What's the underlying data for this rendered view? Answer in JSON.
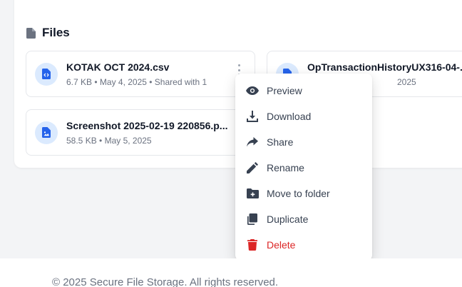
{
  "section": {
    "title": "Files",
    "icon": "document-icon"
  },
  "files": [
    {
      "name": "KOTAK OCT 2024.csv",
      "meta": "6.7 KB • May 4, 2025 • Shared with 1",
      "icon": "code-file-icon"
    },
    {
      "name": "OpTransactionHistoryUX316-04-...",
      "meta": "2025",
      "icon": "document-file-icon"
    },
    {
      "name": "Screenshot 2025-02-19 220856.p...",
      "meta": "58.5 KB • May 5, 2025",
      "icon": "image-file-icon"
    }
  ],
  "menu": {
    "items": [
      {
        "label": "Preview",
        "icon": "eye-icon"
      },
      {
        "label": "Download",
        "icon": "download-icon"
      },
      {
        "label": "Share",
        "icon": "share-icon"
      },
      {
        "label": "Rename",
        "icon": "pencil-icon"
      },
      {
        "label": "Move to folder",
        "icon": "folder-plus-icon"
      },
      {
        "label": "Duplicate",
        "icon": "copy-icon"
      },
      {
        "label": "Delete",
        "icon": "trash-icon"
      }
    ]
  },
  "colors": {
    "accent": "#2563eb",
    "danger": "#dc2626",
    "icon_bg": "#dbeafe"
  },
  "footer": {
    "text": "© 2025 Secure File Storage. All rights reserved."
  }
}
